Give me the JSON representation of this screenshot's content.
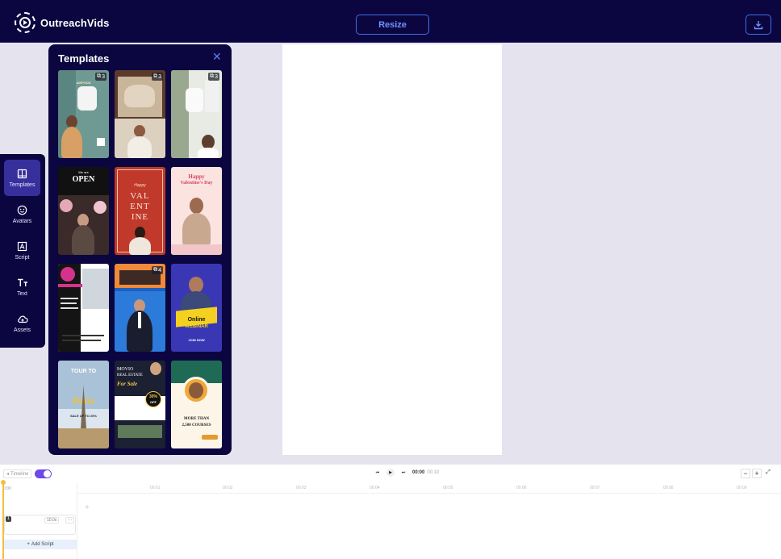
{
  "app": {
    "name": "OutreachVids"
  },
  "header": {
    "resize_label": "Resize",
    "download_icon": "download-icon"
  },
  "colors": {
    "navy": "#0c0640",
    "accent": "#3e6fe8",
    "active": "#372f9c",
    "toggle": "#6c4ae8",
    "playhead": "#f0c040"
  },
  "sidebar": {
    "items": [
      {
        "label": "Templates",
        "icon": "template-icon",
        "active": true
      },
      {
        "label": "Avatars",
        "icon": "avatar-icon",
        "active": false
      },
      {
        "label": "Script",
        "icon": "script-icon",
        "active": false
      },
      {
        "label": "Text",
        "icon": "text-icon",
        "active": false
      },
      {
        "label": "Assets",
        "icon": "cloud-icon",
        "active": false
      }
    ]
  },
  "templates_panel": {
    "title": "Templates",
    "close_icon": "close-icon",
    "templates": [
      {
        "badge": "3",
        "lines": [
          "AIRPODS"
        ]
      },
      {
        "badge": "3",
        "lines": []
      },
      {
        "badge": "3",
        "lines": []
      },
      {
        "badge": "",
        "lines": [
          "We are",
          "OPEN"
        ]
      },
      {
        "badge": "",
        "lines": [
          "Happy",
          "VAL",
          "ENT",
          "INE"
        ]
      },
      {
        "badge": "",
        "lines": [
          "Happy",
          "Valentine's Day"
        ]
      },
      {
        "badge": "",
        "lines": []
      },
      {
        "badge": "4",
        "lines": []
      },
      {
        "badge": "",
        "lines": [
          "Online",
          "WEBINAR",
          "JOIN NOW"
        ]
      },
      {
        "badge": "",
        "lines": [
          "TOUR TO",
          "Paris",
          "SALE UP TO 20%"
        ]
      },
      {
        "badge": "",
        "lines": [
          "MOVIO",
          "REAL ESTATE",
          "For Sale",
          "30%",
          "OFF"
        ]
      },
      {
        "badge": "",
        "lines": [
          "MORE THAN",
          "2,500 COURSES"
        ]
      }
    ]
  },
  "timeline": {
    "label": "Timeline",
    "time_current": "00:00",
    "time_total": "00:10",
    "ruler_start": "0:00",
    "ticks": [
      "00:01",
      "00:02",
      "00:03",
      "00:04",
      "00:05",
      "00:06",
      "00:07",
      "00:08",
      "00:09",
      "00:10"
    ],
    "scene_number": "1",
    "scene_duration": "10.0s",
    "scene_more": "···",
    "add_script": "Add Script",
    "zoom_out": "−",
    "zoom_in": "+"
  }
}
